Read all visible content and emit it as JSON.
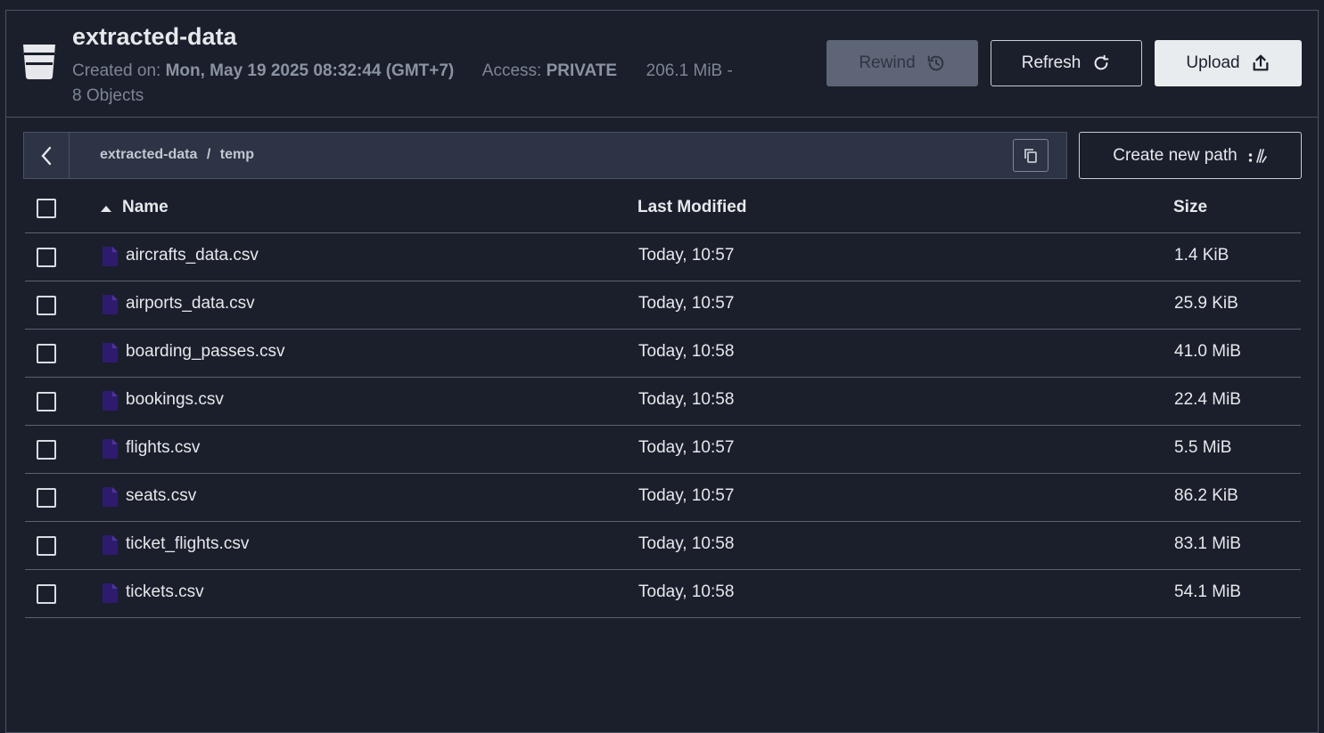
{
  "header": {
    "title": "extracted-data",
    "created_label": "Created on:",
    "created_value": "Mon, May 19 2025 08:32:44 (GMT+7)",
    "access_label": "Access:",
    "access_value": "PRIVATE",
    "size_summary": "206.1 MiB -",
    "objects_summary": "8 Objects",
    "rewind_label": "Rewind",
    "refresh_label": "Refresh",
    "upload_label": "Upload"
  },
  "path": {
    "bucket": "extracted-data",
    "separator": "/",
    "folder": "temp",
    "create_new_path_label": "Create new path"
  },
  "table": {
    "columns": {
      "name": "Name",
      "modified": "Last Modified",
      "size": "Size"
    },
    "rows": [
      {
        "name": "aircrafts_data.csv",
        "modified": "Today, 10:57",
        "size": "1.4 KiB"
      },
      {
        "name": "airports_data.csv",
        "modified": "Today, 10:57",
        "size": "25.9 KiB"
      },
      {
        "name": "boarding_passes.csv",
        "modified": "Today, 10:58",
        "size": "41.0 MiB"
      },
      {
        "name": "bookings.csv",
        "modified": "Today, 10:58",
        "size": "22.4 MiB"
      },
      {
        "name": "flights.csv",
        "modified": "Today, 10:57",
        "size": "5.5 MiB"
      },
      {
        "name": "seats.csv",
        "modified": "Today, 10:57",
        "size": "86.2 KiB"
      },
      {
        "name": "ticket_flights.csv",
        "modified": "Today, 10:58",
        "size": "83.1 MiB"
      },
      {
        "name": "tickets.csv",
        "modified": "Today, 10:58",
        "size": "54.1 MiB"
      }
    ]
  },
  "colors": {
    "background": "#1a1f2b",
    "pathbar": "#2d3445",
    "file_icon": "#2d1b6e",
    "rewind_disabled": "#5d6577"
  },
  "icons": {
    "bucket": "bucket-icon",
    "rewind": "history-icon",
    "refresh": "refresh-icon",
    "upload": "upload-icon",
    "back": "chevron-left-icon",
    "copy": "copy-icon",
    "new_path": "new-path-icon",
    "sort": "sort-asc-icon",
    "file": "file-icon"
  }
}
